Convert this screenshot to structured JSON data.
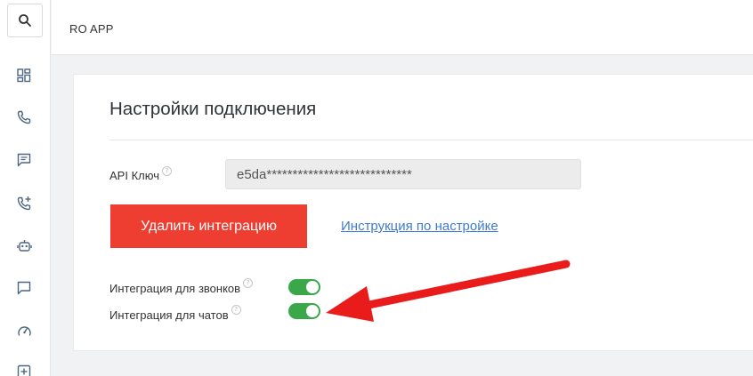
{
  "header": {
    "app_title": "RO APP"
  },
  "sidebar": {
    "items": [
      {
        "icon": "dashboard-icon"
      },
      {
        "icon": "phone-icon"
      },
      {
        "icon": "chat-icon"
      },
      {
        "icon": "phone-add-icon"
      },
      {
        "icon": "robot-icon"
      },
      {
        "icon": "message-icon"
      },
      {
        "icon": "speedometer-icon"
      },
      {
        "icon": "plus-square-icon"
      }
    ]
  },
  "card": {
    "title": "Настройки подключения",
    "api_key_label": "API Ключ",
    "api_key_value": "e5da****************************",
    "delete_button": "Удалить интеграцию",
    "guide_link": "Инструкция по настройке",
    "toggles": [
      {
        "label": "Интеграция для звонков",
        "enabled": true
      },
      {
        "label": "Интеграция для чатов",
        "enabled": true
      }
    ]
  },
  "colors": {
    "accent_red": "#ee3e31",
    "toggle_green": "#3aa849",
    "link_blue": "#3d7bd3",
    "annotation_arrow": "#ea1b1b"
  }
}
